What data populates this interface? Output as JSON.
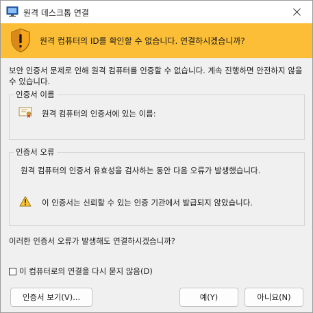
{
  "window": {
    "title": "원격 데스크톱 연결"
  },
  "banner": {
    "text": "원격 컴퓨터의 ID를 확인할 수 없습니다. 연결하시겠습니까?"
  },
  "intro": {
    "text": "보안 인증서 문제로 인해 원격 컴퓨터를 인증할 수 없습니다. 계속 진행하면 안전하지 않을 수 있습니다."
  },
  "cert_name_group": {
    "title": "인증서 이름",
    "label": "원격 컴퓨터의 인증서에 있는 이름:"
  },
  "cert_error_group": {
    "title": "인증서 오류",
    "description": "원격 컴퓨터의 인증서 유효성을 검사하는 동안 다음 오류가 발생했습니다.",
    "warning": "이 인증서는 신뢰할 수 있는 인증 기관에서 발급되지 않았습니다."
  },
  "question": {
    "text": "이러한 인증서 오류가 발생해도 연결하시겠습니까?"
  },
  "checkbox": {
    "label": "이 컴퓨터로의 연결을 다시 묻지 않음(D)",
    "checked": false
  },
  "buttons": {
    "view_cert": "인증서 보기(V)...",
    "yes": "예(Y)",
    "no": "아니요(N)"
  },
  "colors": {
    "banner": "#fbbe36",
    "background": "#f0f0f0"
  },
  "icons": {
    "app": "remote-desktop-icon",
    "close": "close-icon",
    "banner": "shield-warning-icon",
    "cert": "certificate-icon",
    "warning": "warning-icon"
  }
}
